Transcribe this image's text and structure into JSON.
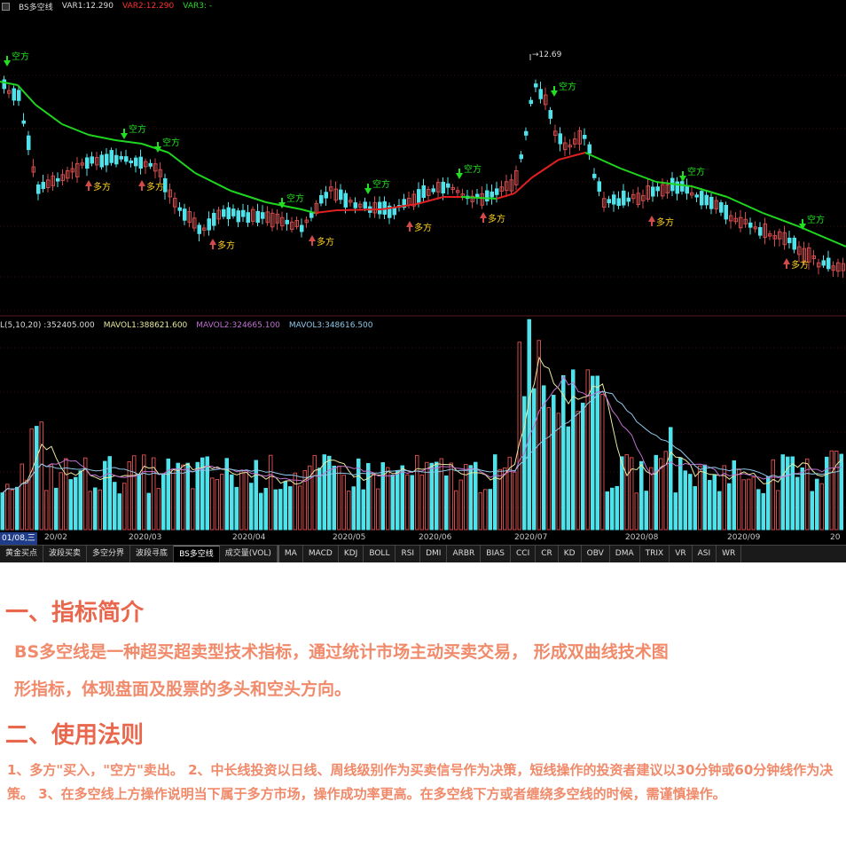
{
  "chart": {
    "price_legend": {
      "title": "BS多空线",
      "var1": "VAR1:12.290",
      "var2": "VAR2:12.290",
      "var3": "VAR3: -"
    },
    "volume_legend": {
      "vol": "L(5,10,20)  :352405.000",
      "mavol1": "MAVOL1:388621.600",
      "mavol2": "MAVOL2:324665.100",
      "mavol3": "MAVOL3:348616.500"
    },
    "peak_label": "12.69",
    "signal_labels": {
      "buy": "多方",
      "sell": "空方"
    },
    "colors": {
      "up": "#d24a4a",
      "down": "#4fe2ea",
      "ma_up": "#e02020",
      "ma_down": "#1fd61f",
      "buy_signal": "#ffd21f",
      "sell_signal": "#21e021",
      "legend_white": "#dcdcdc",
      "legend_red": "#ff3030",
      "legend_green": "#29d929",
      "mavol1": "#e8e8a0",
      "mavol2": "#c070d0",
      "mavol3": "#8ec8e8"
    }
  },
  "date_axis": {
    "cursor_date": "01/08,三",
    "ticks": [
      "20/02",
      "2020/03",
      "2020/04",
      "2020/05",
      "2020/06",
      "2020/07",
      "2020/08",
      "2020/09",
      "20"
    ]
  },
  "tabs": [
    {
      "label": "黄金买点"
    },
    {
      "label": "波段买卖"
    },
    {
      "label": "多空分界"
    },
    {
      "label": "波段寻底"
    },
    {
      "label": "BS多空线"
    },
    {
      "label": "成交量(VOL)"
    },
    {
      "label": "MA"
    },
    {
      "label": "MACD"
    },
    {
      "label": "KDJ"
    },
    {
      "label": "BOLL"
    },
    {
      "label": "RSI"
    },
    {
      "label": "DMI"
    },
    {
      "label": "ARBR"
    },
    {
      "label": "BIAS"
    },
    {
      "label": "CCI"
    },
    {
      "label": "CR"
    },
    {
      "label": "KD"
    },
    {
      "label": "OBV"
    },
    {
      "label": "DMA"
    },
    {
      "label": "TRIX"
    },
    {
      "label": "VR"
    },
    {
      "label": "ASI"
    },
    {
      "label": "WR"
    }
  ],
  "content": {
    "heading1": "一、指标简介",
    "intro_line1": "BS多空线是一种超买超卖型技术指标，通过统计市场主动买卖交易，  形成双曲线技术图",
    "intro_line2": "形指标，体现盘面及股票的多头和空头方向。",
    "heading2": "二、使用法则",
    "rules": "1、多方\"买入，\"空方\"卖出。  2、中长线投资以日线、周线级别作为买卖信号作为决策，短线操作的投资者建议以30分钟或60分钟线作为决策。  3、在多空线上方操作说明当下属于多方市场，操作成功率更高。在多空线下方或者缠绕多空线的时候，需谨慎操作。"
  }
}
